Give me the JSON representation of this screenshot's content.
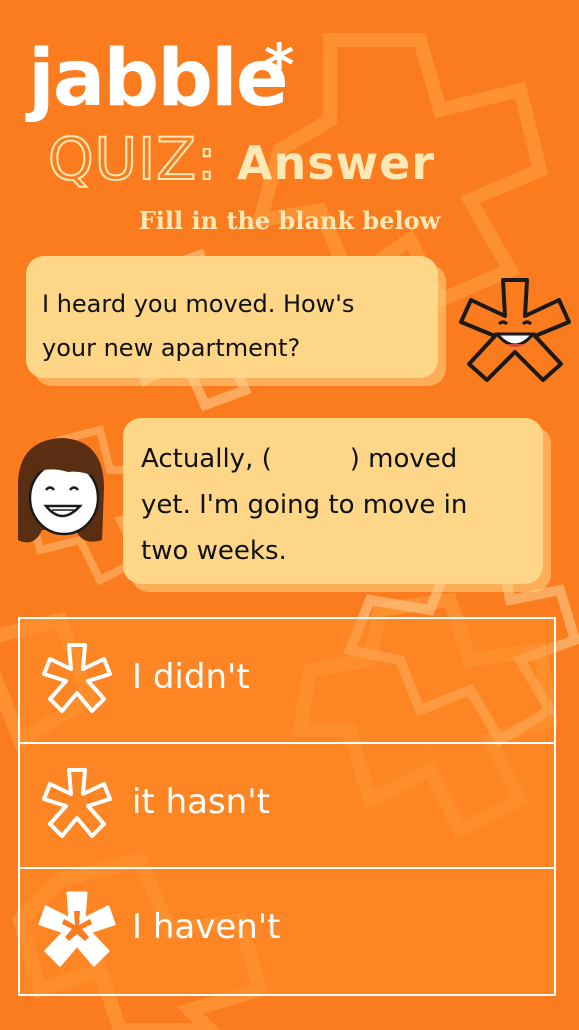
{
  "brand": {
    "logo_text": "jabble",
    "logo_star": "*"
  },
  "header": {
    "title_quiz": "QUIZ:",
    "title_answer": "Answer",
    "subtitle": "Fill in the blank below"
  },
  "conversation": {
    "message_1": {
      "line_1": "I heard you moved. How's",
      "line_2": "your new apartment?"
    },
    "message_2": {
      "line_1_start": "Actually, (",
      "line_1_end": ") moved",
      "line_2": "yet. I'm going to move in",
      "line_3": "two weeks."
    }
  },
  "options": [
    {
      "label": "I didn't",
      "icon": "asterisk-outline-icon"
    },
    {
      "label": "it hasn't",
      "icon": "asterisk-outline-icon"
    },
    {
      "label": "I haven't",
      "icon": "asterisk-filled-icon"
    }
  ],
  "colors": {
    "background": "#fb7c1e",
    "bubble": "#fdd688",
    "title_cream": "#fde9b6",
    "white": "#ffffff"
  }
}
